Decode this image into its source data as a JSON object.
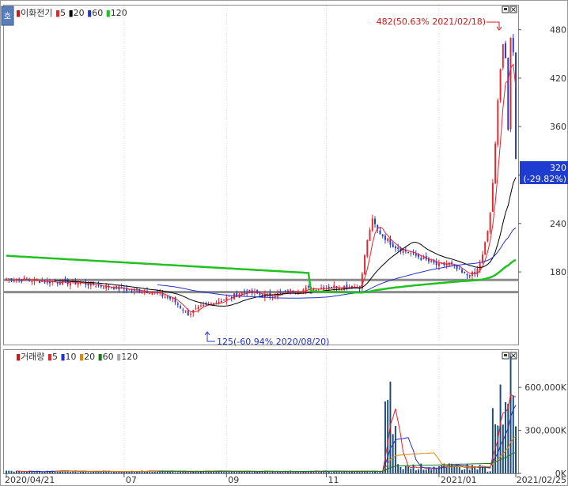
{
  "window": {
    "side_button": "호",
    "price_legend": {
      "name": "이화전기",
      "items": [
        {
          "label": "5",
          "color": "#e8252b"
        },
        {
          "label": "20",
          "color": "#000000"
        },
        {
          "label": "60",
          "color": "#2233cc"
        },
        {
          "label": "120",
          "color": "#22c122"
        }
      ]
    },
    "volume_legend": {
      "name": "거래량",
      "items": [
        {
          "label": "5",
          "color": "#e8252b"
        },
        {
          "label": "10",
          "color": "#2233cc"
        },
        {
          "label": "20",
          "color": "#e08a00"
        },
        {
          "label": "60",
          "color": "#1a7a1a"
        },
        {
          "label": "120",
          "color": "#aaaaaa"
        }
      ]
    }
  },
  "chart_data": [
    {
      "type": "candlestick",
      "name": "price",
      "y_ticks": [
        180,
        240,
        300,
        360,
        420,
        480
      ],
      "ylim": [
        90,
        510
      ],
      "current": {
        "value": "320",
        "change": "(-29.82%)"
      },
      "annotations": [
        {
          "text": "482(50.63% 2021/02/18)",
          "kind": "high"
        },
        {
          "text": "125(-60.94% 2020/08/20)",
          "kind": "low"
        }
      ],
      "horizontal_lines": [
        170,
        155
      ],
      "series_info": "price shape traced approximately from the chart"
    },
    {
      "type": "bar",
      "name": "volume",
      "y_ticks": [
        {
          "value": 0,
          "label": "0K"
        },
        {
          "value": 300000,
          "label": "300,000K"
        },
        {
          "value": 600000,
          "label": "600,000K"
        }
      ],
      "ylim": [
        0,
        860000
      ]
    }
  ],
  "x_axis": {
    "labels": [
      "2020/04/21",
      "07",
      "09",
      "11",
      "2021/01",
      "2021/02/25"
    ]
  }
}
